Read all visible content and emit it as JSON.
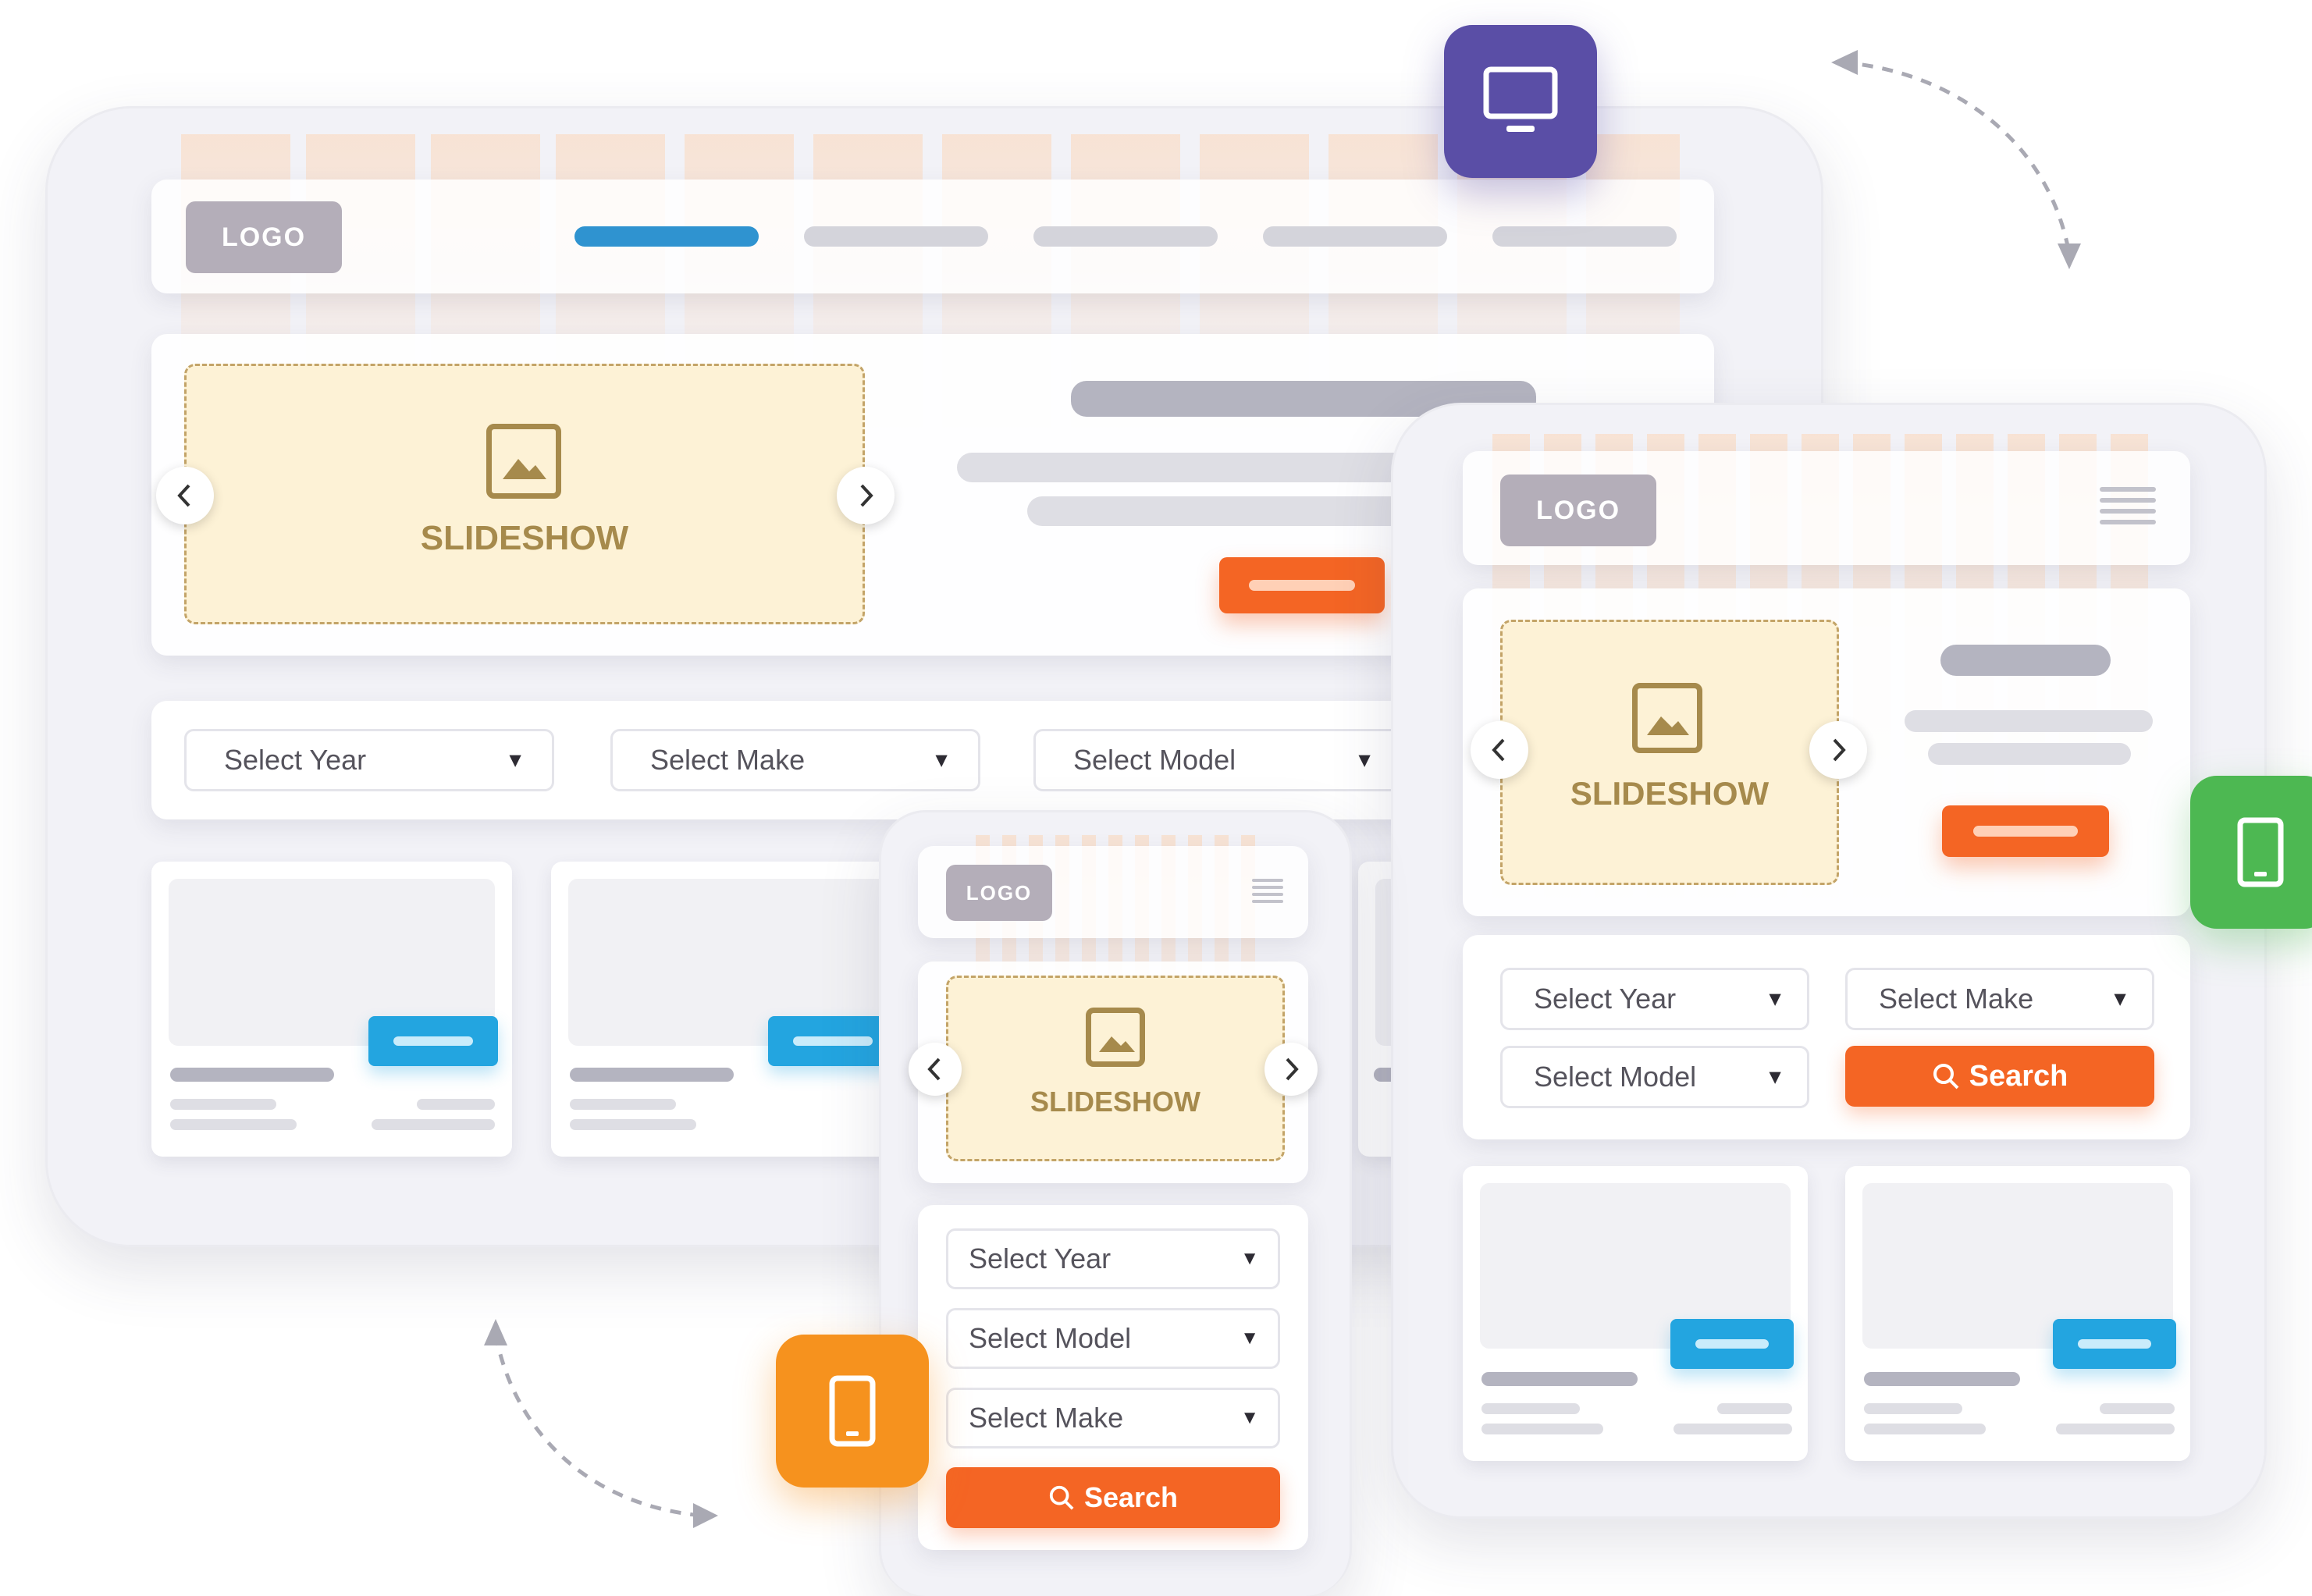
{
  "colors": {
    "desktop_badge": "#5a4ea6",
    "tablet_badge": "#4db852",
    "mobile_badge": "#f6921e",
    "accent_orange": "#f46524",
    "accent_blue": "#23a5e0",
    "slideshow_fill": "#fdf2d6",
    "slideshow_text": "#a68a4c"
  },
  "desktop": {
    "logo": "LOGO",
    "slideshow_label": "SLIDESHOW",
    "selects": [
      "Select Year",
      "Select Make",
      "Select Model"
    ]
  },
  "tablet": {
    "logo": "LOGO",
    "slideshow_label": "SLIDESHOW",
    "selects": [
      "Select Year",
      "Select Make",
      "Select Model"
    ],
    "search_label": "Search"
  },
  "mobile": {
    "logo": "LOGO",
    "slideshow_label": "SLIDESHOW",
    "selects": [
      "Select Year",
      "Select Model",
      "Select Make"
    ],
    "search_label": "Search"
  },
  "icons": {
    "desktop": "monitor-icon",
    "tablet": "tablet-icon",
    "mobile": "mobile-icon",
    "image": "image-icon",
    "search": "search-icon",
    "menu": "hamburger-icon"
  }
}
